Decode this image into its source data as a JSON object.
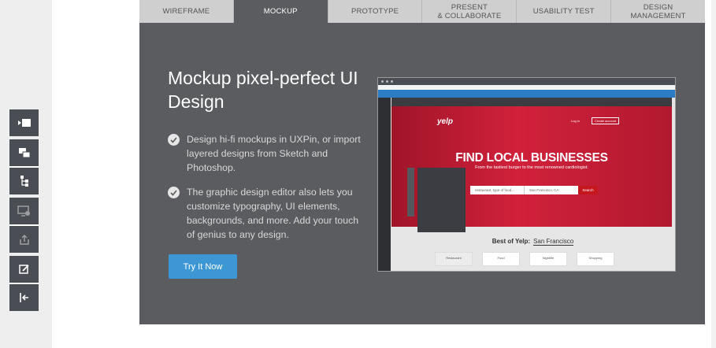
{
  "tabs": [
    {
      "label": "WIREFRAME"
    },
    {
      "label": "MOCKUP"
    },
    {
      "label": "PROTOTYPE"
    },
    {
      "label": "PRESENT\n& COLLABORATE"
    },
    {
      "label": "USABILITY TEST"
    },
    {
      "label": "DESIGN\nMANAGEMENT"
    }
  ],
  "active_tab": "MOCKUP",
  "main": {
    "headline": "Mockup pixel-perfect UI Design",
    "features": [
      {
        "text": "Design hi-fi mockups in UXPin, or import layered designs from Sketch and Photoshop."
      },
      {
        "text": "The graphic design editor also lets you customize typography, UI elements, backgrounds, and more. Add your touch of genius to any design."
      }
    ],
    "cta_label": "Try It Now"
  },
  "mockup": {
    "logo": "yelp",
    "hero_title": "FIND LOCAL BUSINESSES",
    "hero_subtitle": "From the tastiest burger to the most renowned cardiologist.",
    "login": "Log in",
    "signup": "Create account",
    "search_placeholder": "restaurant, type of food...",
    "location": "San Francisco, CA",
    "search_button": "Search",
    "best_of": "Best of Yelp:",
    "best_city": "San Francisco",
    "categories": [
      "Restaurant",
      "Food",
      "Nightlife",
      "Shopping"
    ]
  },
  "toolbar": {
    "icons": [
      "collapse-icon",
      "layers-icon",
      "tree-icon",
      "preview-icon",
      "share-icon",
      "edit-icon",
      "exit-icon"
    ]
  },
  "colors": {
    "panel": "#5b5c60",
    "tab_bar": "#cfcfcf",
    "cta": "#3d97d4",
    "toolbar": "#4a4d53",
    "hero": "#d1213b"
  }
}
